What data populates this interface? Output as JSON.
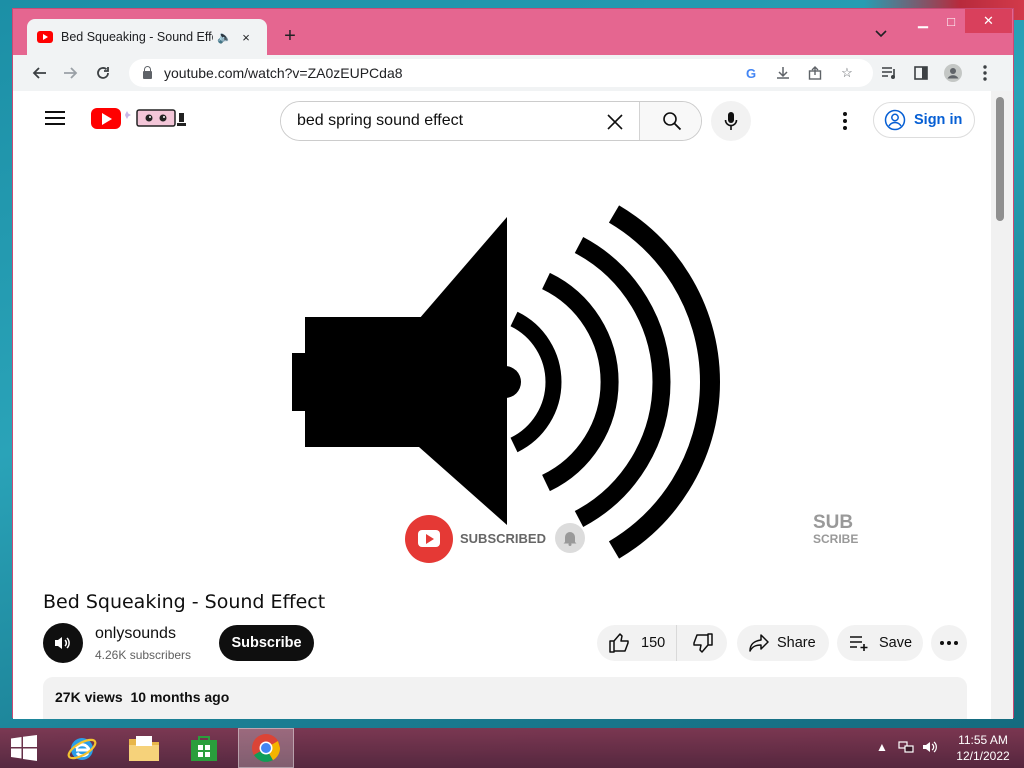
{
  "browser": {
    "tab": {
      "title": "Bed Squeaking - Sound Effect",
      "audio_icon": "speaker-icon",
      "close": "×"
    },
    "new_tab": "+",
    "tab_search_icon": "chevron-down-icon",
    "window_controls": {
      "minimize": "▁",
      "maximize": "□",
      "close": "✕"
    },
    "url": "youtube.com/watch?v=ZA0zEUPCda8"
  },
  "youtube": {
    "search": {
      "value": "bed spring sound effect"
    },
    "sign_in_label": "Sign in",
    "video_overlay": {
      "subscribed_label": "SUBSCRIBED",
      "watermark_line1": "SUB",
      "watermark_line2": "SCRIBE"
    },
    "video_title": "Bed Squeaking - Sound Effect",
    "channel": {
      "name": "onlysounds",
      "subscribers": "4.26K subscribers"
    },
    "subscribe_label": "Subscribe",
    "like_count": "150",
    "share_label": "Share",
    "save_label": "Save",
    "description": {
      "views_and_date": "27K views  10 months ago"
    }
  },
  "taskbar": {
    "clock_time": "11:55 AM",
    "clock_date": "12/1/2022"
  },
  "colors": {
    "youtube_red": "#ff0000",
    "window_frame": "#e56690",
    "link_blue": "#065fd4"
  }
}
